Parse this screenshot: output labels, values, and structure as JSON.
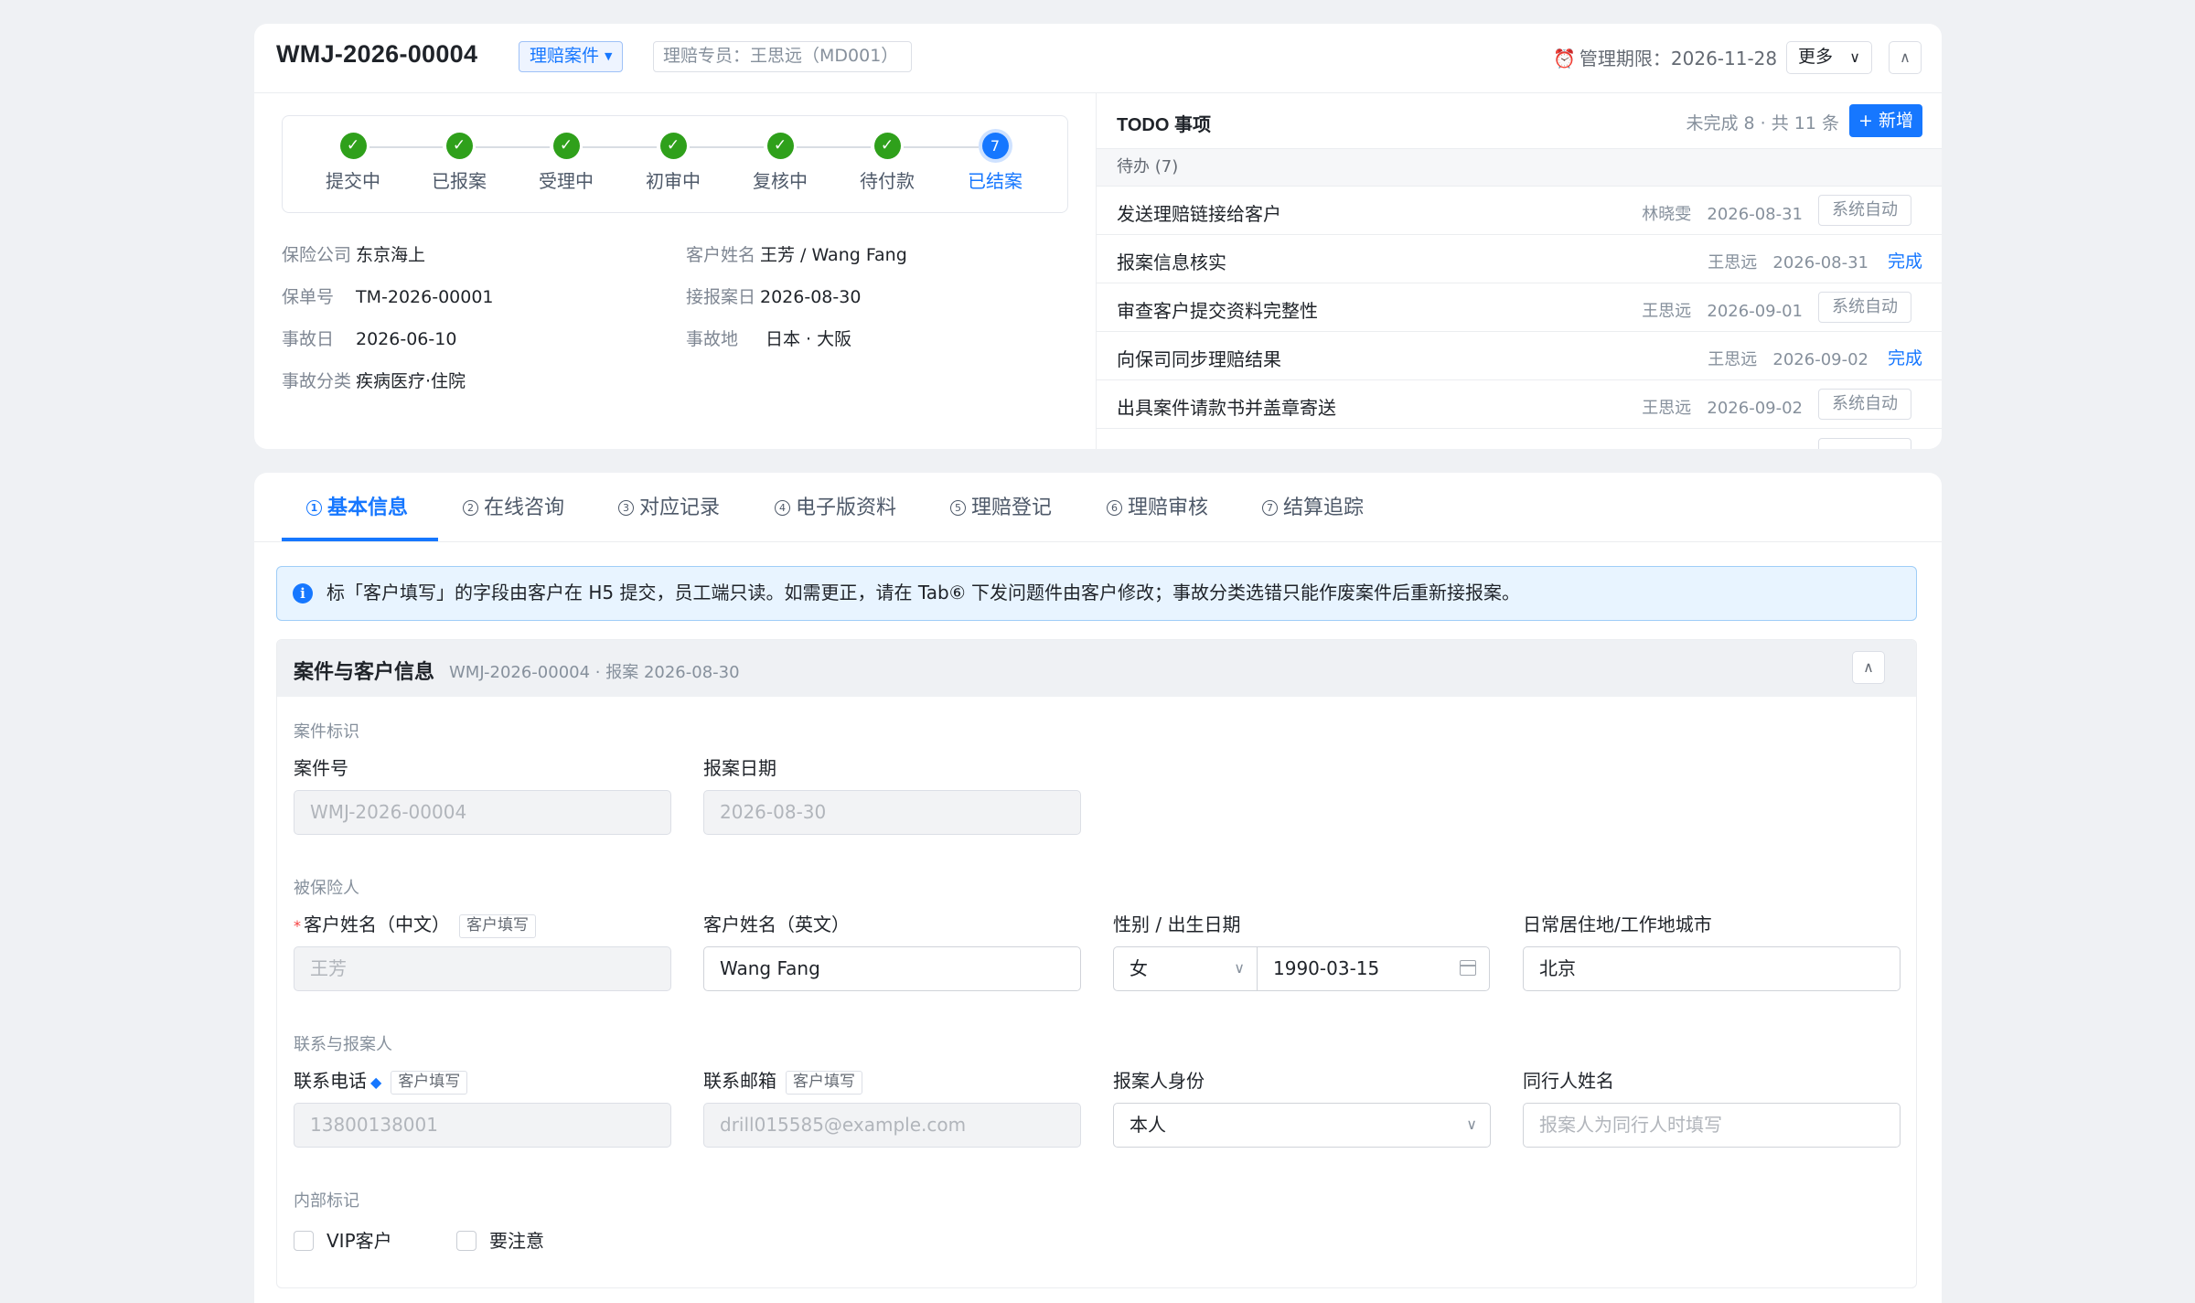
{
  "header": {
    "case_no": "WMJ-2026-00004",
    "case_type": "理赔案件",
    "agent": "理赔专员：王思远（MD001）",
    "deadline": "管理期限：2026-11-28",
    "more": "更多"
  },
  "steps": [
    {
      "label": "提交中",
      "status": "done",
      "mark": "✓"
    },
    {
      "label": "已报案",
      "status": "done",
      "mark": "✓"
    },
    {
      "label": "受理中",
      "status": "done",
      "mark": "✓"
    },
    {
      "label": "初审中",
      "status": "done",
      "mark": "✓"
    },
    {
      "label": "复核中",
      "status": "done",
      "mark": "✓"
    },
    {
      "label": "待付款",
      "status": "done",
      "mark": "✓"
    },
    {
      "label": "已结案",
      "status": "current",
      "mark": "7"
    }
  ],
  "summary": {
    "insurer_k": "保险公司",
    "insurer_v": "东京海上",
    "policy_k": "保单号",
    "policy_v": "TM-2026-00001",
    "accident_date_k": "事故日",
    "accident_date_v": "2026-06-10",
    "category_k": "事故分类",
    "category_v": "疾病医疗·住院",
    "customer_k": "客户姓名",
    "customer_v": "王芳 / Wang Fang",
    "report_date_k": "接报案日",
    "report_date_v": "2026-08-30",
    "place_k": "事故地",
    "place_v": "日本 · 大阪"
  },
  "todo": {
    "title": "TODO 事项",
    "count": "未完成 8 · 共 11 条",
    "add": "+ 新增",
    "group": "待办 (7)",
    "items": [
      {
        "title": "发送理赔链接给客户",
        "owner": "林晓雯",
        "date": "2026-08-31",
        "action": "系统自动",
        "kind": "sys"
      },
      {
        "title": "报案信息核实",
        "owner": "王思远",
        "date": "2026-08-31",
        "action": "完成",
        "kind": "done"
      },
      {
        "title": "审查客户提交资料完整性",
        "owner": "王思远",
        "date": "2026-09-01",
        "action": "系统自动",
        "kind": "sys"
      },
      {
        "title": "向保司同步理赔结果",
        "owner": "王思远",
        "date": "2026-09-02",
        "action": "完成",
        "kind": "done"
      },
      {
        "title": "出具案件请款书并盖章寄送",
        "owner": "王思远",
        "date": "2026-09-02",
        "action": "系统自动",
        "kind": "sys"
      }
    ]
  },
  "tabs": [
    {
      "num": "1",
      "label": "基本信息"
    },
    {
      "num": "2",
      "label": "在线咨询"
    },
    {
      "num": "3",
      "label": "对应记录"
    },
    {
      "num": "4",
      "label": "电子版资料"
    },
    {
      "num": "5",
      "label": "理赔登记"
    },
    {
      "num": "6",
      "label": "理赔审核"
    },
    {
      "num": "7",
      "label": "结算追踪"
    }
  ],
  "notice": "标「客户填写」的字段由客户在 H5 提交，员工端只读。如需更正，请在 Tab⑥ 下发问题件由客户修改；事故分类选错只能作废案件后重新接报案。",
  "section": {
    "title": "案件与客户信息",
    "subtitle": "WMJ-2026-00004 · 报案 2026-08-30",
    "customer_tag": "客户填写",
    "groups": {
      "ident": "案件标识",
      "insured": "被保险人",
      "contact": "联系与报案人",
      "internal": "内部标记"
    },
    "fields": {
      "case_no_label": "案件号",
      "case_no_value": "WMJ-2026-00004",
      "report_date_label": "报案日期",
      "report_date_value": "2026-08-30",
      "name_cn_label": "客户姓名（中文）",
      "name_cn_value": "王芳",
      "name_en_label": "客户姓名（英文）",
      "name_en_value": "Wang Fang",
      "gender_dob_label": "性别 / 出生日期",
      "gender_value": "女",
      "dob_value": "1990-03-15",
      "city_label": "日常居住地/工作地城市",
      "city_value": "北京",
      "phone_label": "联系电话",
      "phone_value": "13800138001",
      "email_label": "联系邮箱",
      "email_value": "drill015585@example.com",
      "reporter_label": "报案人身份",
      "reporter_value": "本人",
      "companion_label": "同行人姓名",
      "companion_placeholder": "报案人为同行人时填写"
    },
    "checkboxes": {
      "vip": "VIP客户",
      "attention": "要注意"
    }
  }
}
